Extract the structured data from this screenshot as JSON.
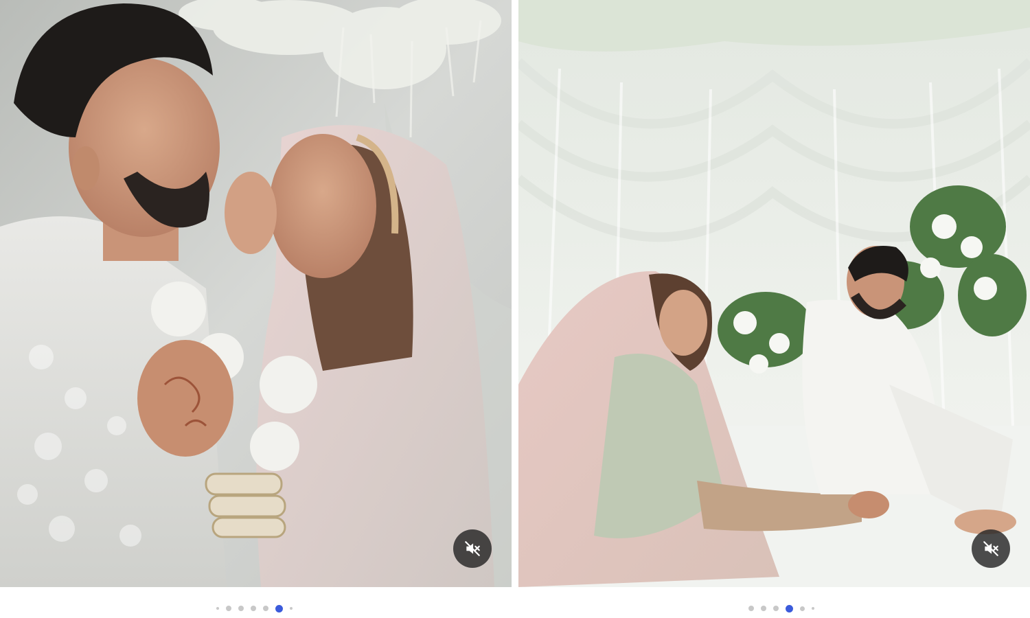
{
  "posts": [
    {
      "id": "left",
      "scene": "portrait",
      "mute_icon": "speaker-muted-icon",
      "carousel": {
        "total": 7,
        "active_index": 5,
        "dot_color": "#c8c8c8",
        "active_color": "#3b5bdb"
      }
    },
    {
      "id": "right",
      "scene": "seated",
      "mute_icon": "speaker-muted-icon",
      "carousel": {
        "total": 6,
        "active_index": 3,
        "dot_color": "#c8c8c8",
        "active_color": "#3b5bdb"
      }
    }
  ],
  "colors": {
    "background": "#ffffff",
    "mute_button_bg": "#262626",
    "active_dot": "#3b5bdb"
  }
}
